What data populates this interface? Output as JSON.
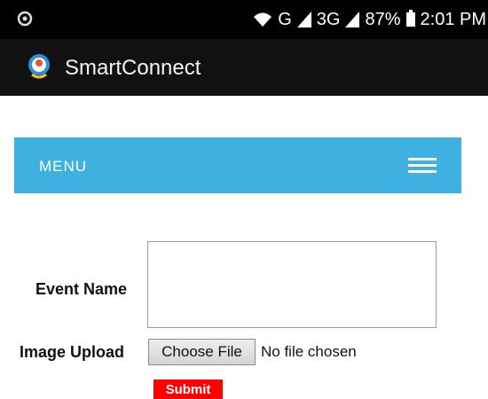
{
  "status_bar": {
    "network_g": "G",
    "network_3g": "3G",
    "battery": "87%",
    "time": "2:01 PM",
    "icons": [
      "circle-indicator-icon",
      "wifi-icon",
      "signal-icon",
      "signal-icon",
      "battery-icon"
    ]
  },
  "app_bar": {
    "title": "SmartConnect",
    "logo_icon": "smartconnect-logo-icon"
  },
  "menu": {
    "label": "MENU",
    "icon": "hamburger-icon",
    "color": "#3eb1e0"
  },
  "form": {
    "event_name_label": "Event Name",
    "event_name_value": "",
    "image_upload_label": "Image Upload",
    "choose_file_label": "Choose File",
    "file_status": "No file chosen",
    "submit_label": "Submit",
    "submit_color": "#ff0000"
  }
}
